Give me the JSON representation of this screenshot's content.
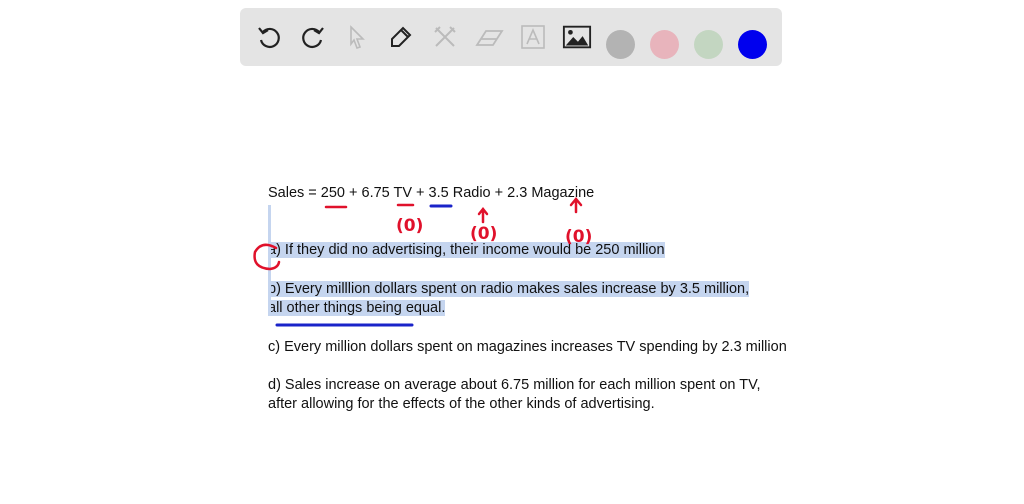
{
  "toolbar": {
    "tools": [
      "undo",
      "redo",
      "select",
      "pen",
      "tools",
      "eraser",
      "text",
      "image"
    ],
    "colors": [
      "#b3b3b3",
      "#e8b4bc",
      "#c3d6c1",
      "#0000ee"
    ],
    "active_color": "#0000ee"
  },
  "content": {
    "equation": "Sales = 250 + 6.75 TV + 3.5 Radio + 2.3 Magazine",
    "a": "a) If they did no advertising, their income would be 250 million",
    "b1": "b) Every milllion dollars spent on radio makes sales increase by 3.5 million,",
    "b2": "all other things being equal.",
    "c": "c) Every million dollars spent on magazines increases TV spending by 2.3 million",
    "d1": "d) Sales increase on average about 6.75 million for each million spent on TV,",
    "d2": "after allowing for the effects of the other kinds of advertising."
  },
  "annotations": {
    "marks": [
      "(0)",
      "(0)",
      "(0)"
    ],
    "red": "#e0112b",
    "blue": "#1a23c9"
  }
}
